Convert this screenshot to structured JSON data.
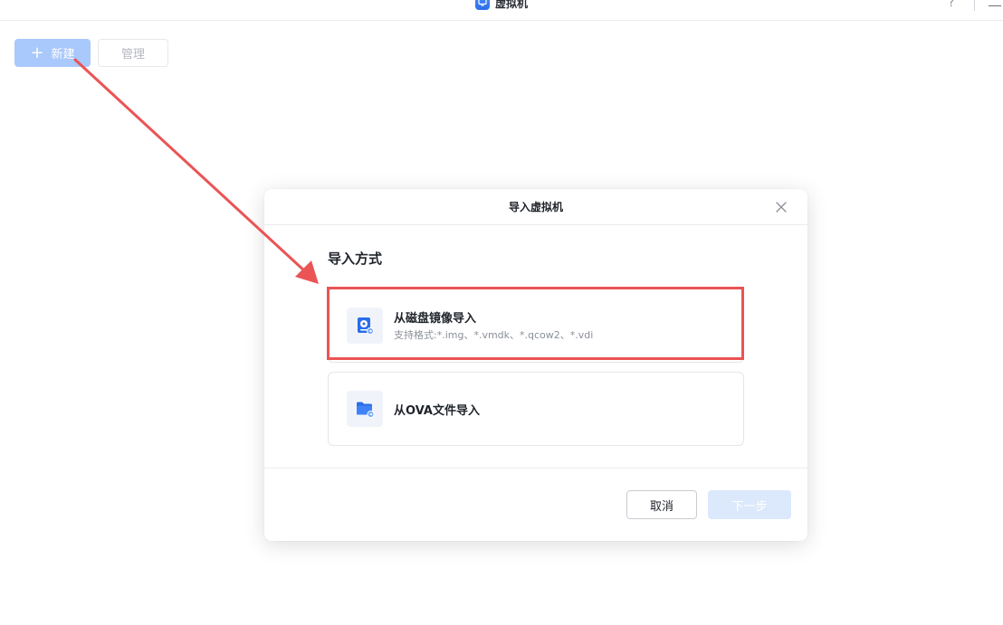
{
  "app": {
    "title": "虚拟机",
    "help_icon": "?",
    "accent_color": "#2b6de8"
  },
  "toolbar": {
    "new_label": "新建",
    "manage_label": "管理"
  },
  "dialog": {
    "title": "导入虚拟机",
    "section_title": "导入方式",
    "options": [
      {
        "title": "从磁盘镜像导入",
        "description": "支持格式:*.img、*.vmdk、*.qcow2、*.vdi",
        "icon": "disk-image-icon"
      },
      {
        "title": "从OVA文件导入",
        "icon": "folder-icon"
      }
    ],
    "cancel_label": "取消",
    "next_label": "下一步"
  },
  "annotation": {
    "color": "#ea5455"
  }
}
